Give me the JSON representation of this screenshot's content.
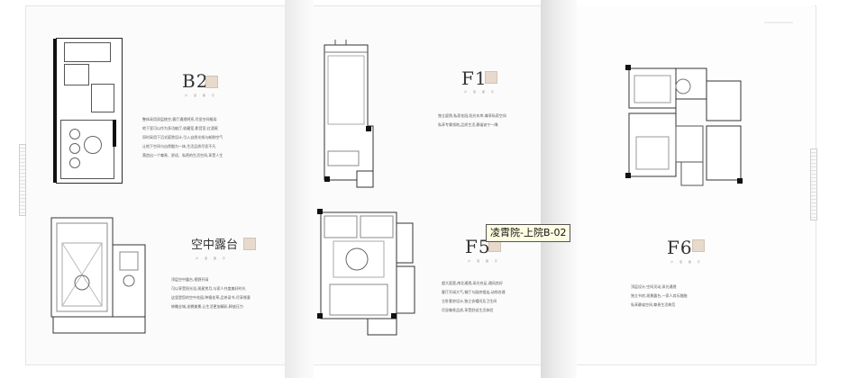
{
  "tooltip": {
    "text": "凌霄院-上院B-02"
  },
  "sections": {
    "b2": {
      "title": "B2",
      "sub": "户 · 型 · 展 · 示",
      "lines": [
        "整体采用双层挑空,客厅通透明亮,尽显空间格局",
        "地下室可以作为多功能厅,收藏室,影音室,红酒窖",
        "同时采用下沉式庭院设计,引入自然光线与新鲜空气",
        "让地下空间与自然融为一体,生活品质尽显不凡",
        "营造出一个尊贵、舒适、私密的生活空间,享受人生"
      ]
    },
    "roof": {
      "title": "空中露台",
      "sub": "户 · 型 · 展 · 示",
      "lines": [
        "顶层空中露台,视野开阔",
        "可以享受阳光浴,观星赏月,与家人共度美好时光",
        "这里是您的空中花园,种植花草,品茶读书,尽享惬意",
        "俯瞰全城,坐拥美景,让生活更加精彩,释放压力"
      ]
    },
    "f1": {
      "title": "F1",
      "sub": "户 · 型 · 展 · 示",
      "lines": [
        "独立庭院,私家花园,阳光车库,尊享私家空间",
        "私享专属领地,品质生活,静谧安宁一隅"
      ]
    },
    "f5": {
      "title": "F5",
      "sub": "户 · 型 · 展 · 示",
      "lines": [
        "超大面宽,南北通透,采光充足,通风良好",
        "客厅开阔大气,餐厅与厨房相连,动线合理",
        "主卧套房设计,独立衣帽间及卫生间",
        "尽显尊贵品质,享受舒适生活体验"
      ]
    },
    "f6": {
      "title": "F6",
      "sub": "户 · 型 · 展 · 示",
      "lines": [
        "顶层设计,空间灵动,采光通透",
        "独立书房,观景露台,一家人其乐融融",
        "私享静谧空间,尊贵生活典范"
      ]
    }
  }
}
